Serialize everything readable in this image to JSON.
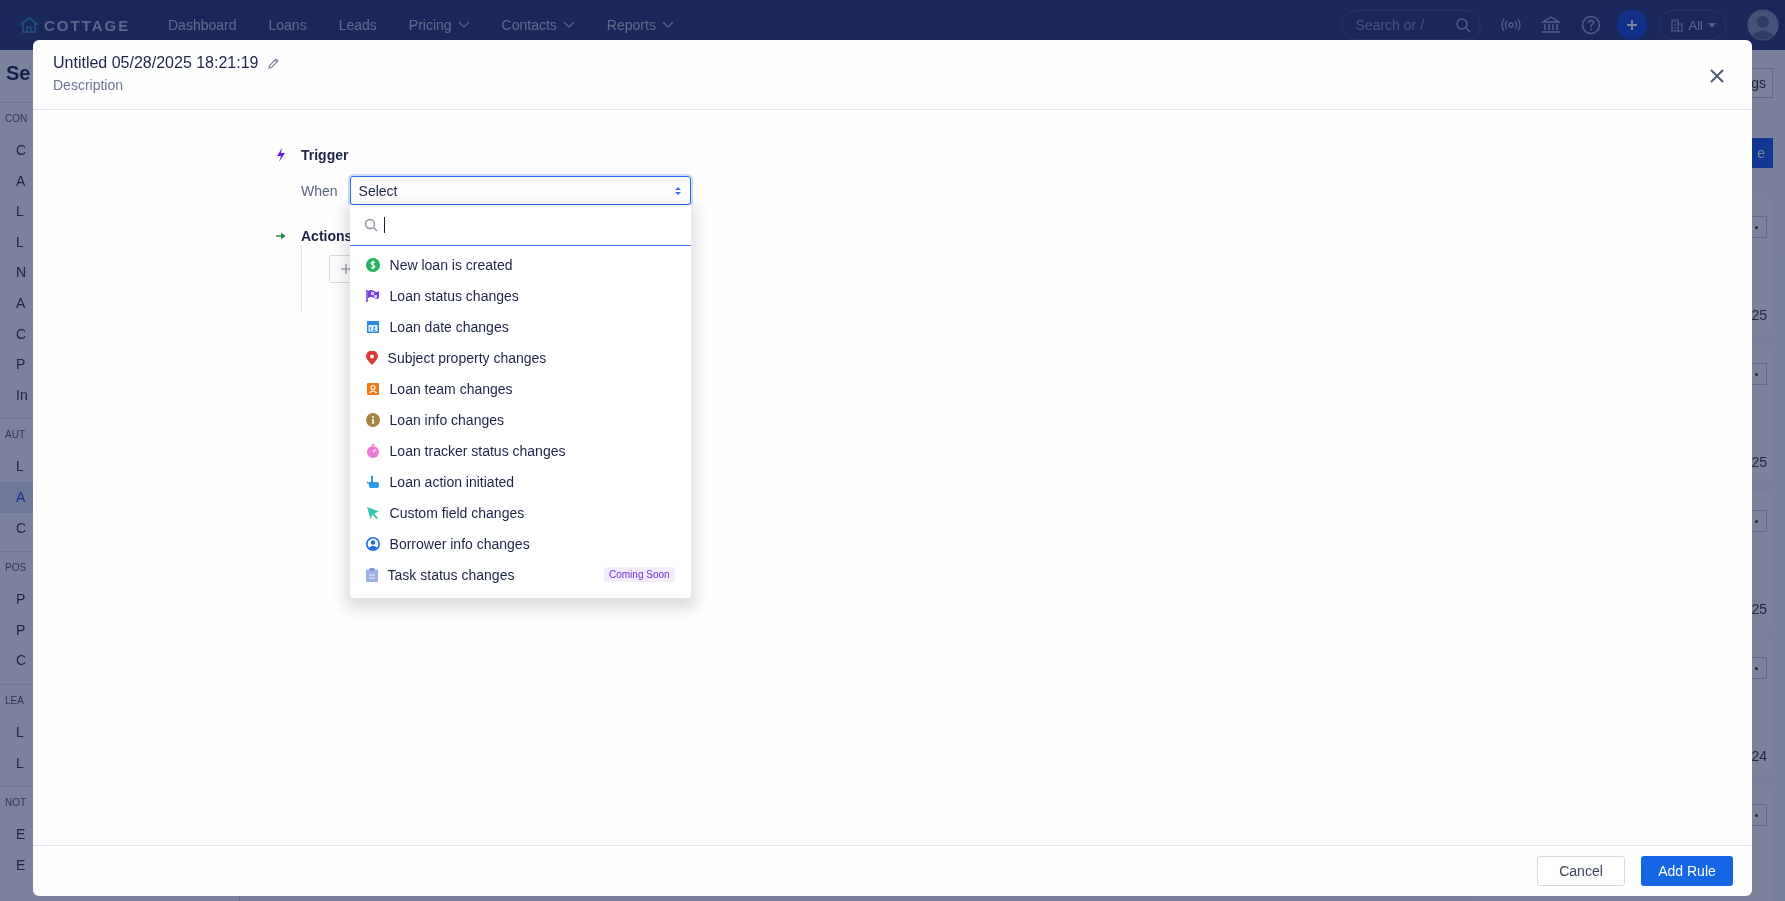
{
  "nav": {
    "logo": "COTTAGE",
    "items": [
      {
        "label": "Dashboard",
        "dropdown": false
      },
      {
        "label": "Loans",
        "dropdown": false
      },
      {
        "label": "Leads",
        "dropdown": false
      },
      {
        "label": "Pricing",
        "dropdown": true
      },
      {
        "label": "Contacts",
        "dropdown": true
      },
      {
        "label": "Reports",
        "dropdown": true
      }
    ],
    "search": {
      "placeholder": "Search or /"
    },
    "filter": "All"
  },
  "background": {
    "sidebar": {
      "heading": "Se",
      "sections": [
        {
          "heading": "CON",
          "items": [
            {
              "label": "C",
              "selected": false
            },
            {
              "label": "A",
              "selected": false
            },
            {
              "label": "L",
              "selected": false
            },
            {
              "label": "L",
              "selected": false
            },
            {
              "label": "N",
              "selected": false
            },
            {
              "label": "A",
              "selected": false
            },
            {
              "label": "C",
              "selected": false
            },
            {
              "label": "P",
              "selected": false
            },
            {
              "label": "In",
              "selected": false
            }
          ]
        },
        {
          "heading": "AUT",
          "items": [
            {
              "label": "L",
              "selected": false
            },
            {
              "label": "A",
              "selected": true
            },
            {
              "label": "C",
              "selected": false
            }
          ]
        },
        {
          "heading": "POS",
          "items": [
            {
              "label": "P",
              "selected": false
            },
            {
              "label": "P",
              "selected": false
            },
            {
              "label": "C",
              "selected": false
            }
          ]
        },
        {
          "heading": "LEA",
          "items": [
            {
              "label": "L",
              "selected": false
            },
            {
              "label": "L",
              "selected": false
            }
          ]
        },
        {
          "heading": "NOT",
          "items": [
            {
              "label": "E",
              "selected": false
            },
            {
              "label": "E",
              "selected": false
            }
          ]
        }
      ]
    },
    "right": {
      "header_button": "gs",
      "primary_button": "e",
      "cards": [
        {
          "date": "25"
        },
        {
          "date": "25"
        },
        {
          "date": "25"
        },
        {
          "date": "24"
        }
      ]
    }
  },
  "modal": {
    "title": "Untitled 05/28/2025 18:21:19",
    "description": "Description",
    "trigger": {
      "label": "Trigger",
      "when": "When",
      "select": {
        "value": "Select",
        "open": true
      },
      "options": [
        {
          "label": "New loan is created",
          "kind": "dollar"
        },
        {
          "label": "Loan status changes",
          "kind": "flag"
        },
        {
          "label": "Loan date changes",
          "kind": "calendar"
        },
        {
          "label": "Subject property changes",
          "kind": "pin"
        },
        {
          "label": "Loan team changes",
          "kind": "contact"
        },
        {
          "label": "Loan info changes",
          "kind": "info"
        },
        {
          "label": "Loan tracker status changes",
          "kind": "timer"
        },
        {
          "label": "Loan action initiated",
          "kind": "hand"
        },
        {
          "label": "Custom field changes",
          "kind": "cursor"
        },
        {
          "label": "Borrower info changes",
          "kind": "user"
        },
        {
          "label": "Task status changes",
          "kind": "clipboard",
          "badge": "Coming Soon"
        }
      ]
    },
    "actions": {
      "label": "Actions"
    },
    "buttons": {
      "cancel": "Cancel",
      "submit": "Add Rule"
    }
  }
}
